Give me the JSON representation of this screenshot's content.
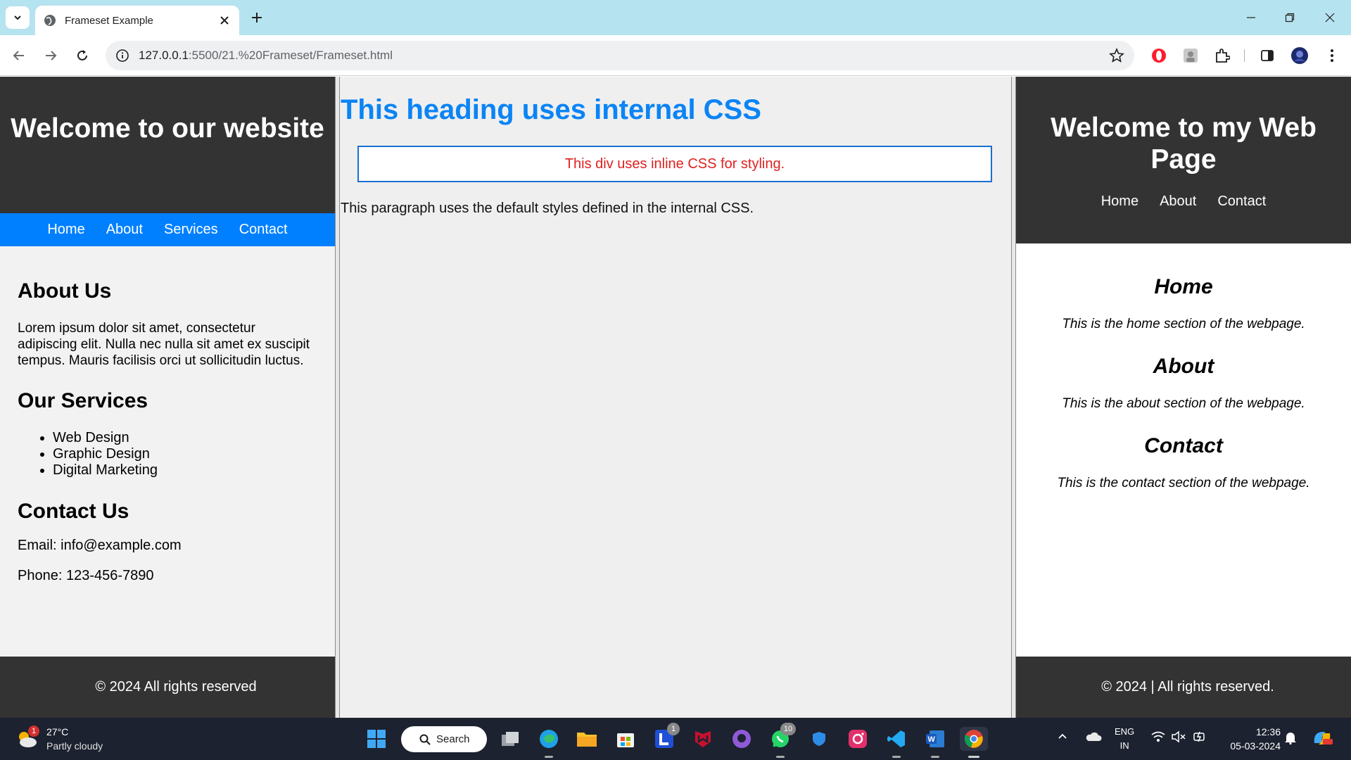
{
  "browser": {
    "tab_title": "Frameset Example",
    "url_host": "127.0.0.1",
    "url_path": ":5500/21.%20Frameset/Frameset.html"
  },
  "left_frame": {
    "title": "Welcome to our website",
    "nav": [
      "Home",
      "About",
      "Services",
      "Contact"
    ],
    "about_heading": "About Us",
    "about_text": "Lorem ipsum dolor sit amet, consectetur adipiscing elit. Nulla nec nulla sit amet ex suscipit tempus. Mauris facilisis orci ut sollicitudin luctus.",
    "services_heading": "Our Services",
    "services": [
      "Web Design",
      "Graphic Design",
      "Digital Marketing"
    ],
    "contact_heading": "Contact Us",
    "email": "Email: info@example.com",
    "phone": "Phone: 123-456-7890",
    "footer": "© 2024 All rights reserved"
  },
  "center_frame": {
    "heading": "This heading uses internal CSS",
    "box_text": "This div uses inline CSS for styling.",
    "paragraph": "This paragraph uses the default styles defined in the internal CSS."
  },
  "right_frame": {
    "title": "Welcome to my Web Page",
    "nav": [
      "Home",
      "About",
      "Contact"
    ],
    "sections": [
      {
        "heading": "Home",
        "text": "This is the home section of the webpage."
      },
      {
        "heading": "About",
        "text": "This is the about section of the webpage."
      },
      {
        "heading": "Contact",
        "text": "This is the contact section of the webpage."
      }
    ],
    "footer": "© 2024 | All rights reserved."
  },
  "taskbar": {
    "weather_temp": "27°C",
    "weather_desc": "Partly cloudy",
    "weather_badge": "1",
    "search_label": "Search",
    "app_badges": {
      "launcher": "1",
      "whatsapp": "10"
    },
    "lang_top": "ENG",
    "lang_bottom": "IN",
    "time": "12:36",
    "date": "05-03-2024"
  },
  "colors": {
    "center_heading": "#0b84f5",
    "left_nav": "#0080ff",
    "box_text": "#e02020",
    "dark_panel": "#333333"
  }
}
